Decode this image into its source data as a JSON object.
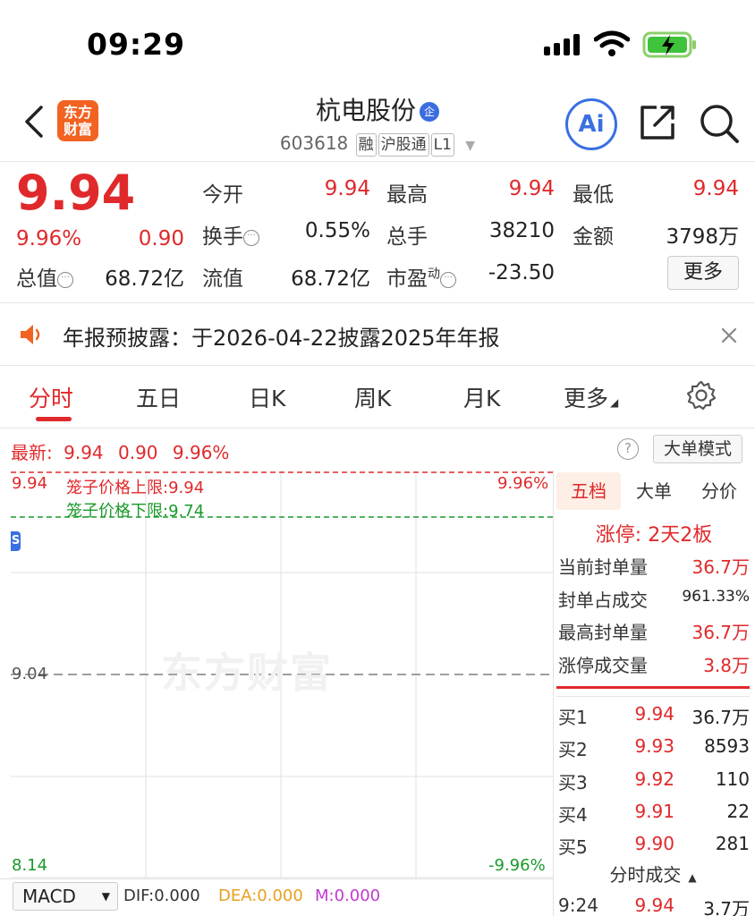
{
  "status_bar": {
    "time": "09:29"
  },
  "header": {
    "logo_line1": "东方",
    "logo_line2": "财富",
    "stock_name": "杭电股份",
    "name_badge": "企",
    "stock_code": "603618",
    "tags": [
      "融",
      "沪股通",
      "L1"
    ],
    "ai_label": "Ai"
  },
  "quote": {
    "price": "9.94",
    "change_pct": "9.96%",
    "change": "0.90",
    "fields": [
      {
        "label": "今开",
        "value": "9.94"
      },
      {
        "label": "最高",
        "value": "9.94"
      },
      {
        "label": "最低",
        "value": "9.94"
      },
      {
        "label": "换手",
        "value": "0.55%"
      },
      {
        "label": "总手",
        "value": "38210"
      },
      {
        "label": "金额",
        "value": "3798万"
      },
      {
        "label": "总值",
        "value": "68.72亿"
      },
      {
        "label": "流值",
        "value": "68.72亿"
      },
      {
        "label": "市盈",
        "sup": "动",
        "value": "-23.50"
      }
    ],
    "more_label": "更多"
  },
  "notice": {
    "text": "年报预披露：于2026-04-22披露2025年年报"
  },
  "tabs": [
    "分时",
    "五日",
    "日K",
    "周K",
    "月K",
    "更多"
  ],
  "chart_bar": {
    "latest_label": "最新:",
    "latest_price": "9.94",
    "latest_change": "0.90",
    "latest_pct": "9.96%",
    "help": "?",
    "bigorder_label": "大单模式"
  },
  "chart": {
    "top_left": "9.94",
    "top_right": "9.96%",
    "upper_limit_label": "笼子价格上限:",
    "upper_limit_value": "9.94",
    "lower_limit_label": "笼子价格下限:",
    "lower_limit_value": "9.74",
    "mid_left": "9.04",
    "bottom_left": "8.14",
    "bottom_right": "-9.96%",
    "watermark": "东方财富",
    "s_badge": "S"
  },
  "right_panel": {
    "tabs": [
      "五档",
      "大单",
      "分价"
    ],
    "limit_title": "涨停: 2天2板",
    "stats": [
      {
        "label": "当前封单量",
        "value": "36.7万"
      },
      {
        "label": "封单占成交",
        "value": "961.33%"
      },
      {
        "label": "最高封单量",
        "value": "36.7万"
      },
      {
        "label": "涨停成交量",
        "value": "3.8万"
      }
    ],
    "bids": [
      {
        "name": "买1",
        "price": "9.94",
        "vol": "36.7万"
      },
      {
        "name": "买2",
        "price": "9.93",
        "vol": "8593"
      },
      {
        "name": "买3",
        "price": "9.92",
        "vol": "110"
      },
      {
        "name": "买4",
        "price": "9.91",
        "vol": "22"
      },
      {
        "name": "买5",
        "price": "9.90",
        "vol": "281"
      }
    ],
    "trades_title": "分时成交",
    "trades": [
      {
        "time": "9:24",
        "price": "9.94",
        "vol": "3.7万"
      }
    ]
  },
  "indicator": {
    "name": "MACD",
    "dif": "DIF:0.000",
    "dea": "DEA:0.000",
    "m": "M:0.000"
  },
  "colors": {
    "up_red": "#e0292b",
    "down_green": "#1a9a2a",
    "accent_blue": "#3a6fe3",
    "brand_orange": "#f26322"
  }
}
